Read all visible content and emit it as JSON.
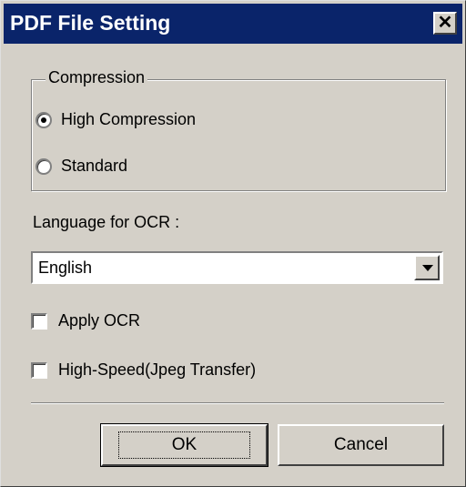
{
  "dialog": {
    "title": "PDF File Setting",
    "close_symbol": "✕"
  },
  "compression": {
    "label": "Compression",
    "options": [
      {
        "label": "High Compression",
        "checked": true
      },
      {
        "label": "Standard",
        "checked": false
      }
    ]
  },
  "ocr_language": {
    "label": "Language for OCR :",
    "selected": "English"
  },
  "checkboxes": {
    "apply_ocr": {
      "label": "Apply OCR",
      "checked": false
    },
    "high_speed": {
      "label": "High-Speed(Jpeg Transfer)",
      "checked": false
    }
  },
  "buttons": {
    "ok": "OK",
    "cancel": "Cancel"
  },
  "colors": {
    "title_bar": "#0a246a",
    "face": "#d4d0c8"
  }
}
